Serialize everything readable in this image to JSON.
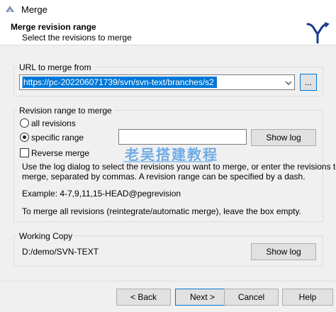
{
  "window": {
    "title": "Merge"
  },
  "header": {
    "title": "Merge revision range",
    "subtitle": "Select the revisions to merge"
  },
  "url_group": {
    "label": "URL to merge from",
    "url_value": "https://pc-202206071739/svn/svn-text/branches/s2",
    "browse_label": "..."
  },
  "range_group": {
    "label": "Revision range to merge",
    "all_revisions_label": "all revisions",
    "specific_range_label": "specific range",
    "specific_range_value": "",
    "show_log_label": "Show log",
    "reverse_merge_label": "Reverse merge",
    "help_text_1": "Use the log dialog to select the revisions you want to merge, or enter the revisions to",
    "help_text_2": "merge, separated by commas. A revision range can be specified by a dash.",
    "example_text": "Example: 4-7,9,11,15-HEAD@pegrevision",
    "empty_text": "To merge all revisions (reintegrate/automatic merge), leave the box empty."
  },
  "working_copy_group": {
    "label": "Working Copy",
    "path": "D:/demo/SVN-TEXT",
    "show_log_label": "Show log"
  },
  "buttons": {
    "back": "< Back",
    "next": "Next >",
    "cancel": "Cancel",
    "help": "Help"
  },
  "watermark": {
    "text": "老吴搭建教程"
  },
  "selected_radio": "specific_range",
  "reverse_merge_checked": false,
  "colors": {
    "selection": "#0078d7",
    "watermark": "#4696e1",
    "logo": "#1a3c8c"
  }
}
